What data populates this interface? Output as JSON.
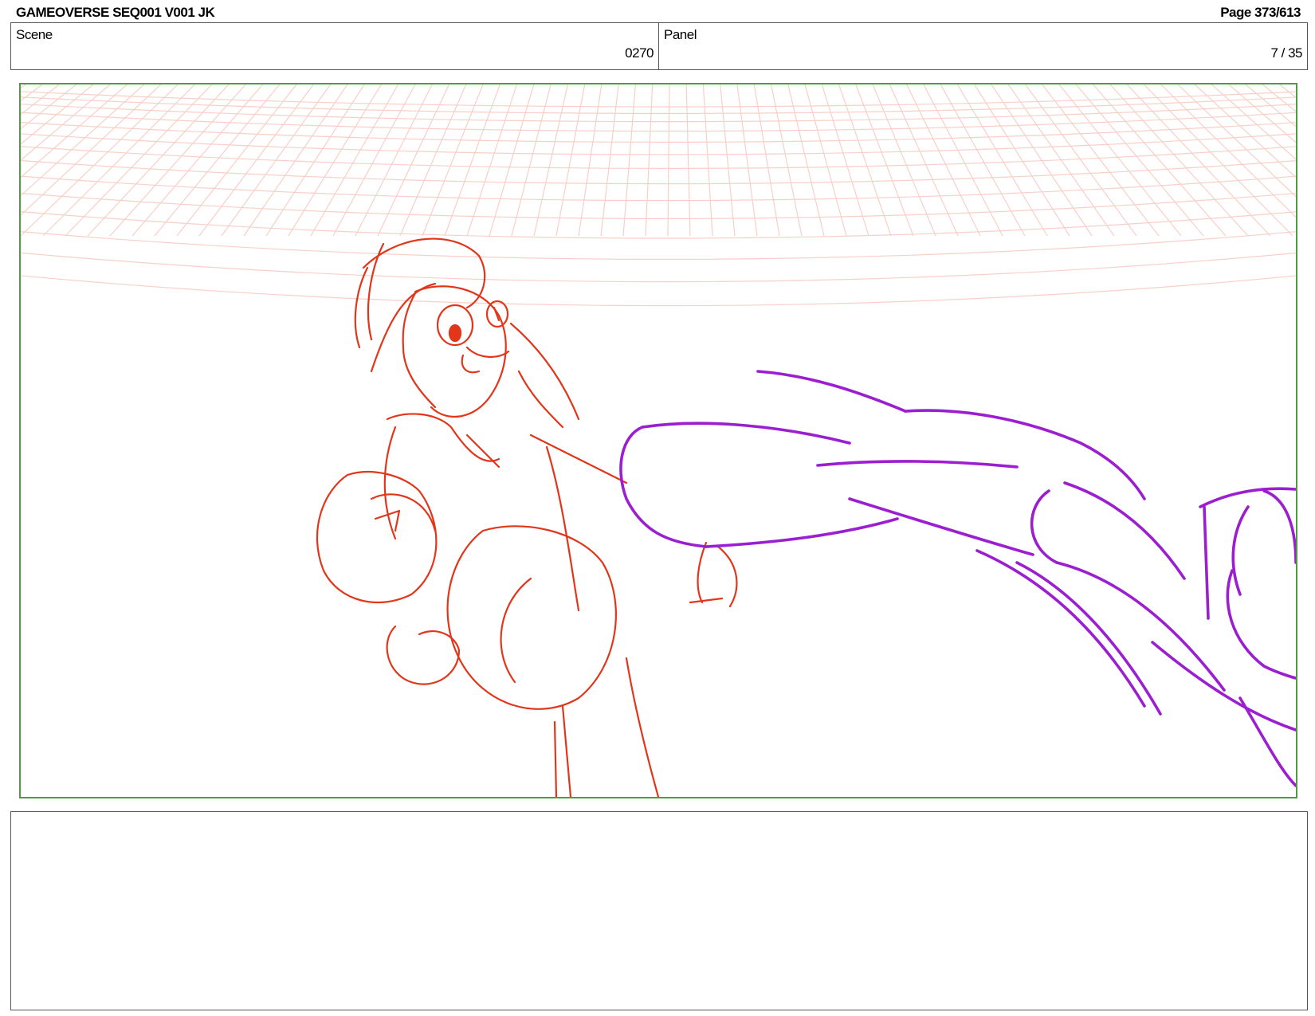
{
  "header": {
    "title": "GAMEOVERSE SEQ001 V001 JK",
    "page": "Page 373/613"
  },
  "info": {
    "scene_label": "Scene",
    "scene_value": "0270",
    "panel_label": "Panel",
    "panel_value": "7 / 35"
  },
  "drawing": {
    "grid_color": "#f4a89a",
    "character_left_color": "#e2361a",
    "character_right_color": "#9b1fd1",
    "frame_border_color": "#4f9a43"
  },
  "notes": {
    "text": ""
  }
}
